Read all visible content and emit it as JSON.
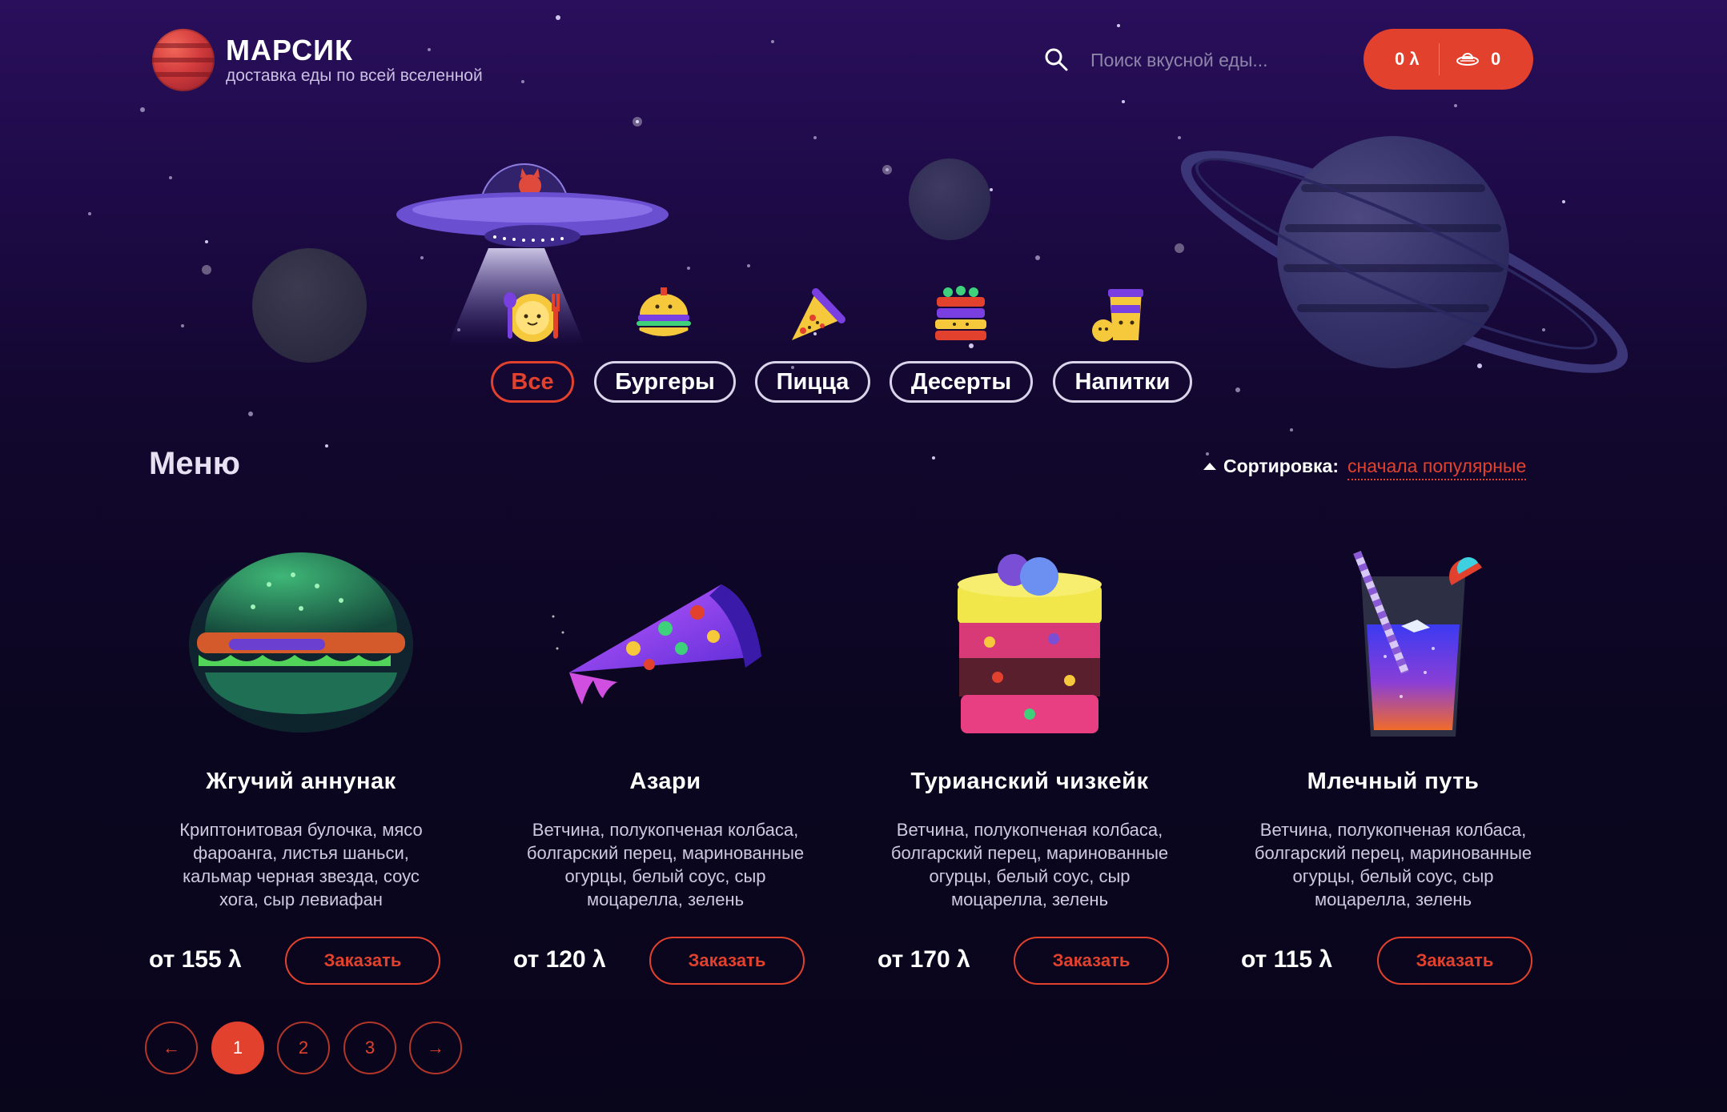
{
  "header": {
    "brand_name": "МАРСИК",
    "brand_tagline": "доставка еды по всей вселенной",
    "search_placeholder": "Поиск вкусной еды...",
    "cart_total": "0 λ",
    "cart_count": "0"
  },
  "categories": [
    {
      "label": "Все",
      "icon": "plate-with-cutlery-icon",
      "active": true
    },
    {
      "label": "Бургеры",
      "icon": "burger-icon",
      "active": false
    },
    {
      "label": "Пицца",
      "icon": "pizza-slice-icon",
      "active": false
    },
    {
      "label": "Десерты",
      "icon": "cake-icon",
      "active": false
    },
    {
      "label": "Напитки",
      "icon": "drink-cup-icon",
      "active": false
    }
  ],
  "menu": {
    "title": "Меню",
    "sort_label": "Сортировка:",
    "sort_value": "сначала популярные"
  },
  "products": [
    {
      "name": "Жгучий аннунак",
      "description": "Криптонитовая булочка, мясо фароанга, листья шаньси, кальмар черная звезда, соус хога, сыр левиафан",
      "price": "от 155 λ",
      "order_label": "Заказать",
      "icon": "burger-image"
    },
    {
      "name": "Азари",
      "description": "Ветчина, полукопченая колбаса, болгарский перец, маринованные огурцы, белый соус, сыр моцарелла, зелень",
      "price": "от 120 λ",
      "order_label": "Заказать",
      "icon": "pizza-image"
    },
    {
      "name": "Турианский чизкейк",
      "description": "Ветчина, полукопченая колбаса, болгарский перец, маринованные огурцы, белый соус, сыр моцарелла, зелень",
      "price": "от 170 λ",
      "order_label": "Заказать",
      "icon": "cheesecake-image"
    },
    {
      "name": "Млечный путь",
      "description": "Ветчина, полукопченая колбаса, болгарский перец, маринованные огурцы, белый соус, сыр моцарелла, зелень",
      "price": "от 115 λ",
      "order_label": "Заказать",
      "icon": "drink-image"
    }
  ],
  "pagination": {
    "prev": "←",
    "pages": [
      "1",
      "2",
      "3"
    ],
    "current": "1",
    "next": "→"
  },
  "colors": {
    "accent": "#e2412e",
    "background_top": "#2a0f5c",
    "background_bottom": "#09051b"
  }
}
